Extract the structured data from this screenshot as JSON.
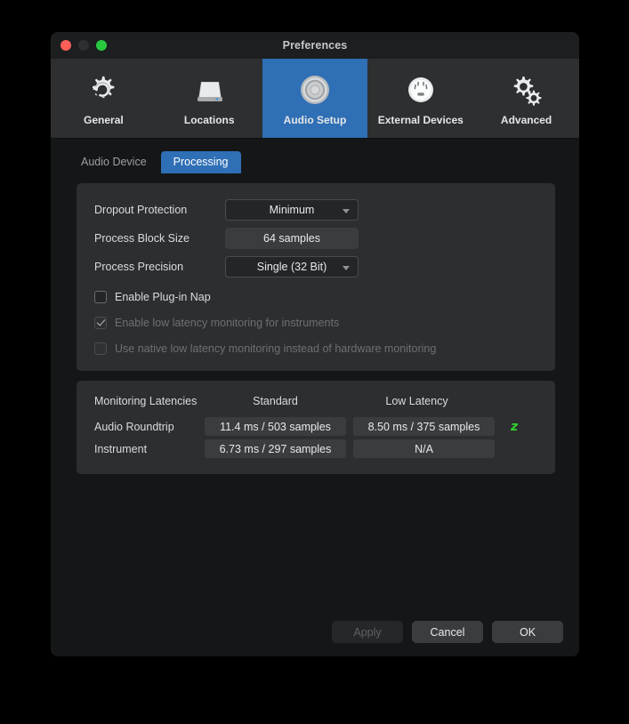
{
  "window": {
    "title": "Preferences",
    "traffic_lights": [
      "close-button",
      "minimize-button",
      "maximize-button"
    ]
  },
  "toolbar": {
    "items": [
      {
        "label": "General",
        "icon": "gear-refresh-icon",
        "active": false
      },
      {
        "label": "Locations",
        "icon": "drive-icon",
        "active": false
      },
      {
        "label": "Audio Setup",
        "icon": "speaker-icon",
        "active": true
      },
      {
        "label": "External Devices",
        "icon": "midi-port-icon",
        "active": false
      },
      {
        "label": "Advanced",
        "icon": "gears-icon",
        "active": false
      }
    ],
    "active_color": "#2f6fb5"
  },
  "tabs": [
    {
      "label": "Audio Device",
      "active": false
    },
    {
      "label": "Processing",
      "active": true
    }
  ],
  "settings": {
    "rows": [
      {
        "label": "Dropout Protection",
        "value": "Minimum",
        "type": "select"
      },
      {
        "label": "Process Block Size",
        "value": "64 samples",
        "type": "readonly"
      },
      {
        "label": "Process Precision",
        "value": "Single (32 Bit)",
        "type": "select"
      }
    ],
    "checkboxes": [
      {
        "label": "Enable Plug-in Nap",
        "checked": false,
        "disabled": false
      },
      {
        "label": "Enable low latency monitoring for instruments",
        "checked": true,
        "disabled": true
      },
      {
        "label": "Use native low latency monitoring instead of hardware monitoring",
        "checked": false,
        "disabled": true
      }
    ]
  },
  "latency": {
    "title": "Monitoring Latencies",
    "columns": [
      "Standard",
      "Low Latency"
    ],
    "rows": [
      {
        "label": "Audio Roundtrip",
        "standard": "11.4 ms / 503 samples",
        "low_latency": "8.50 ms / 375 samples",
        "badge": "z"
      },
      {
        "label": "Instrument",
        "standard": "6.73 ms / 297 samples",
        "low_latency": "N/A",
        "badge": ""
      }
    ],
    "badge_color": "#2fd22f"
  },
  "footer": {
    "apply": "Apply",
    "cancel": "Cancel",
    "ok": "OK"
  }
}
